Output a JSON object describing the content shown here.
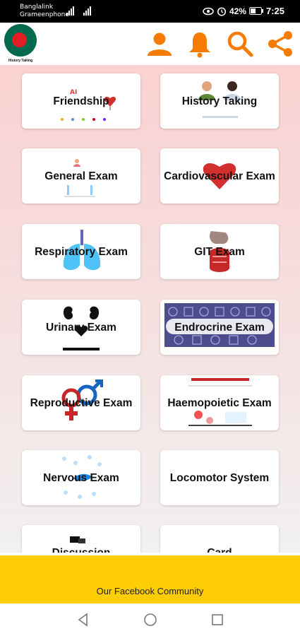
{
  "status_bar": {
    "carrier_line1": "Banglalink",
    "carrier_line2": "Grameenphone",
    "battery": "42%",
    "time": "7:25"
  },
  "app_bar": {
    "logo_caption": "History Taking"
  },
  "cards": [
    {
      "label": "Friendship"
    },
    {
      "label": "History Taking"
    },
    {
      "label": "General Exam"
    },
    {
      "label": "Cardiovascular Exam"
    },
    {
      "label": "Respiratory Exam"
    },
    {
      "label": "GIT Exam"
    },
    {
      "label": "Urinary Exam"
    },
    {
      "label": "Endrocrine Exam"
    },
    {
      "label": "Reproductive Exam"
    },
    {
      "label": "Haemopoietic Exam"
    },
    {
      "label": "Nervous Exam"
    },
    {
      "label": "Locomotor System"
    },
    {
      "label": "Discussion"
    },
    {
      "label": "Card"
    }
  ],
  "footer": {
    "community_label": "Our Facebook Community"
  },
  "colors": {
    "accent": "#f57c00",
    "banner": "#fecd06",
    "flag_green": "#006a4e",
    "flag_red": "#e21d24"
  }
}
